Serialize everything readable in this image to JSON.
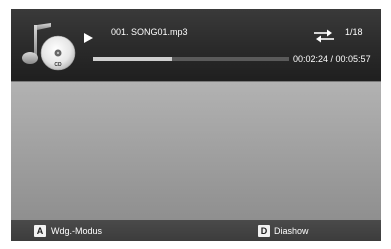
{
  "player": {
    "icon": "music-cd-icon",
    "cd_label": "CD",
    "state_icon": "play-icon",
    "title": "001. SONG01.mp3",
    "repeat_icon": "repeat-icon",
    "track_counter": "1/18",
    "time_display": "00:02:24 / 00:05:57",
    "progress_fraction": 0.403
  },
  "footer": {
    "buttons": [
      {
        "key": "A",
        "label": "Wdg.-Modus"
      },
      {
        "key": "D",
        "label": "Diashow"
      }
    ]
  },
  "colors": {
    "top_band": "#2a2a2a",
    "body": "#a2a2a2",
    "footer": "#404040",
    "text": "#ffffff"
  }
}
